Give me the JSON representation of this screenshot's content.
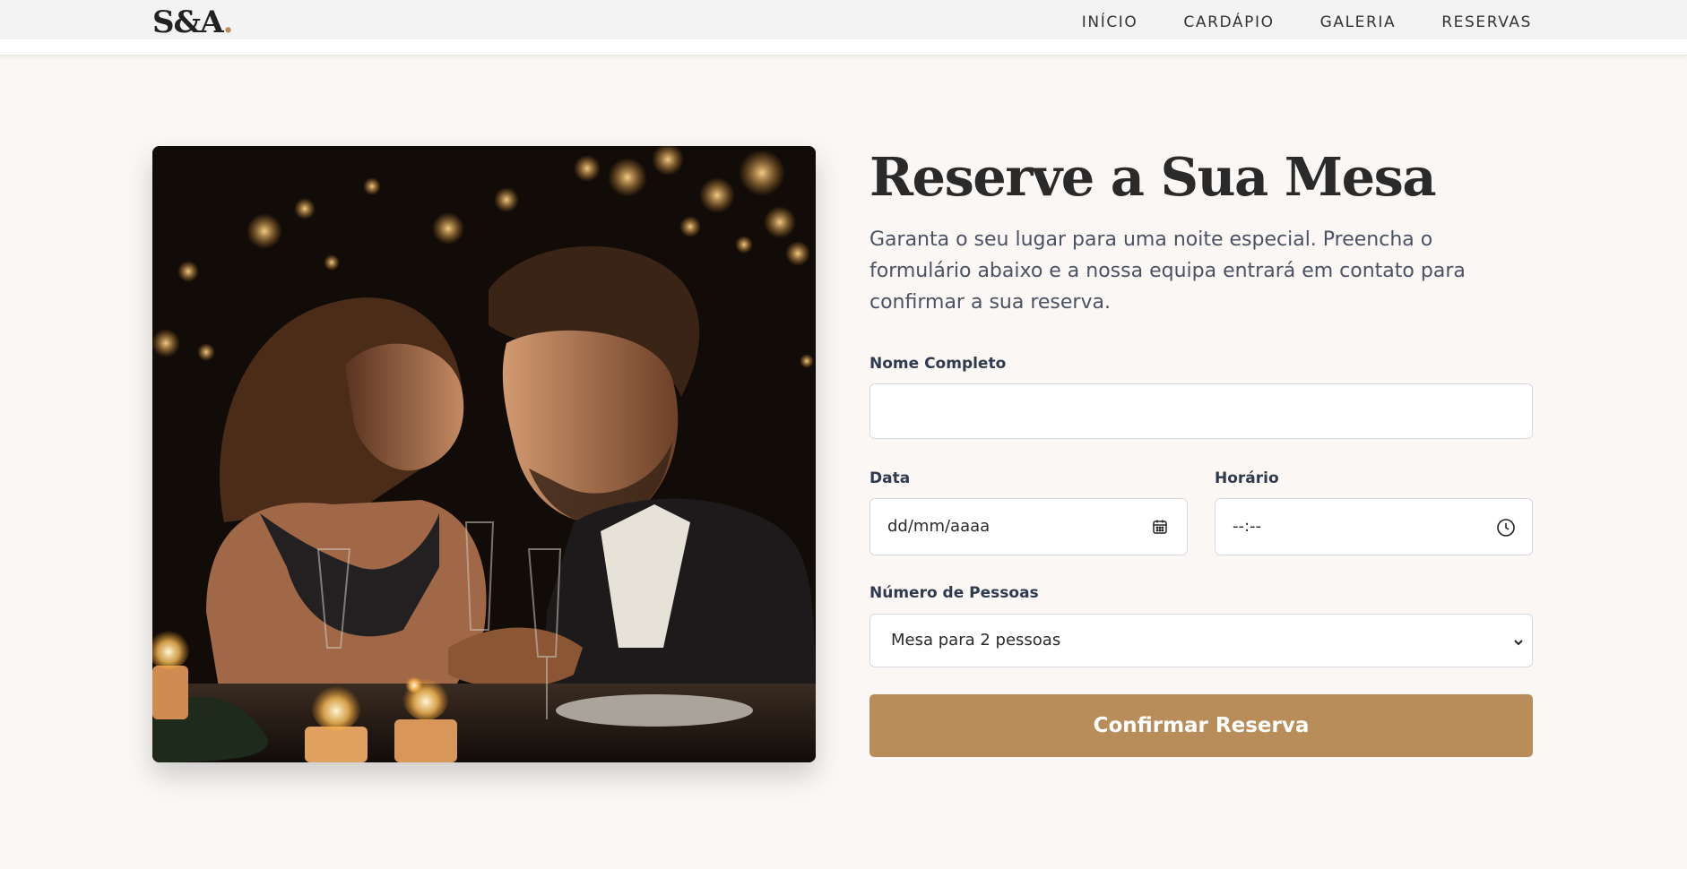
{
  "header": {
    "logo_text": "S&A",
    "logo_dot": ".",
    "nav": [
      {
        "label": "INÍCIO"
      },
      {
        "label": "CARDÁPIO"
      },
      {
        "label": "GALERIA"
      },
      {
        "label": "RESERVAS"
      }
    ]
  },
  "main": {
    "title": "Reserve a Sua Mesa",
    "subtitle": "Garanta o seu lugar para uma noite especial. Preencha o formulário abaixo e a nossa equipa entrará em contato para confirmar a sua reserva.",
    "form": {
      "name_label": "Nome Completo",
      "name_value": "",
      "date_label": "Data",
      "date_placeholder": "dd/mm/aaaa",
      "time_label": "Horário",
      "time_placeholder": "--:--",
      "people_label": "Número de Pessoas",
      "people_selected": "Mesa para 2 pessoas",
      "submit_label": "Confirmar Reserva"
    }
  },
  "colors": {
    "accent": "#b98d5a",
    "background": "#faf7f4",
    "heading": "#2a2a2a",
    "body_text": "#4a5263"
  },
  "icons": [
    "calendar-icon",
    "clock-icon",
    "chevron-down-icon"
  ]
}
